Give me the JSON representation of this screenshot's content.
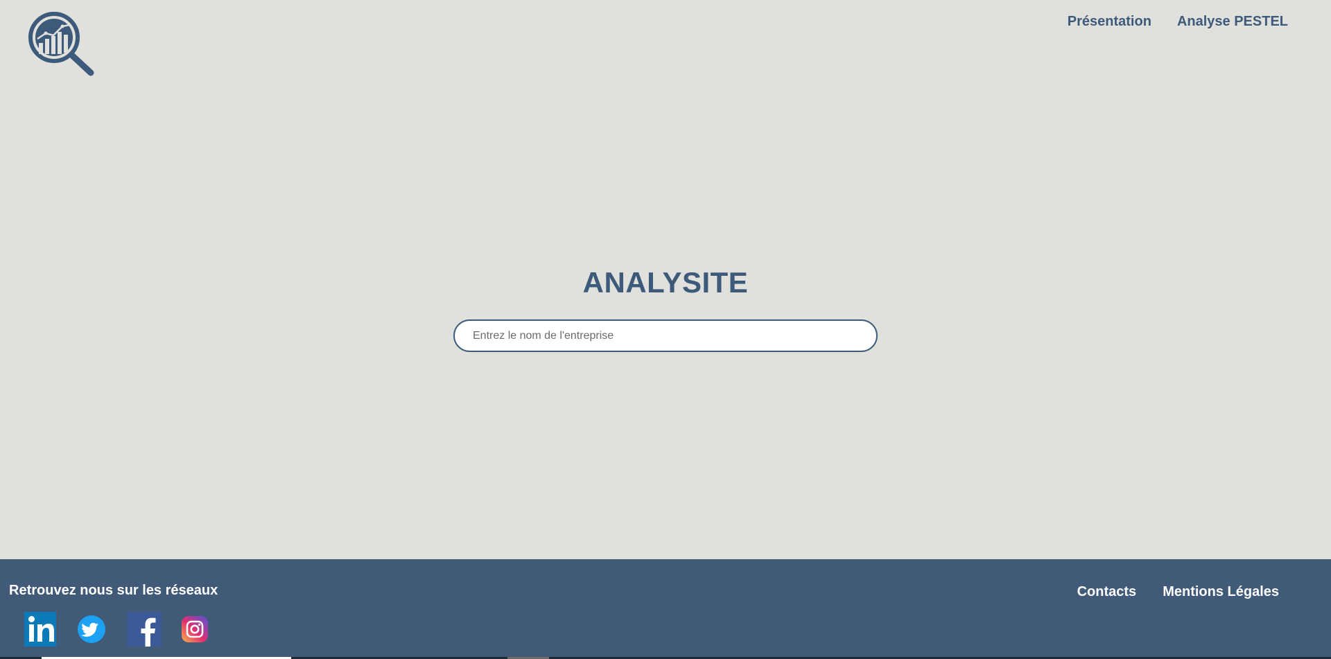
{
  "header": {
    "logo_icon": "magnifier-chart-icon",
    "nav": [
      {
        "label": "Présentation"
      },
      {
        "label": "Analyse PESTEL"
      }
    ]
  },
  "hero": {
    "title": "ANALYSITE",
    "search_placeholder": "Entrez le nom de l'entreprise",
    "search_value": ""
  },
  "footer": {
    "title": "Retrouvez nous sur les réseaux",
    "socials": [
      {
        "icon": "linkedin-icon"
      },
      {
        "icon": "twitter-icon"
      },
      {
        "icon": "facebook-icon"
      },
      {
        "icon": "instagram-icon"
      }
    ],
    "links": [
      {
        "label": "Contacts"
      },
      {
        "label": "Mentions Légales"
      }
    ]
  },
  "colors": {
    "background": "#e0e0dc",
    "accent": "#3e5a7a",
    "footer": "#415a78"
  }
}
